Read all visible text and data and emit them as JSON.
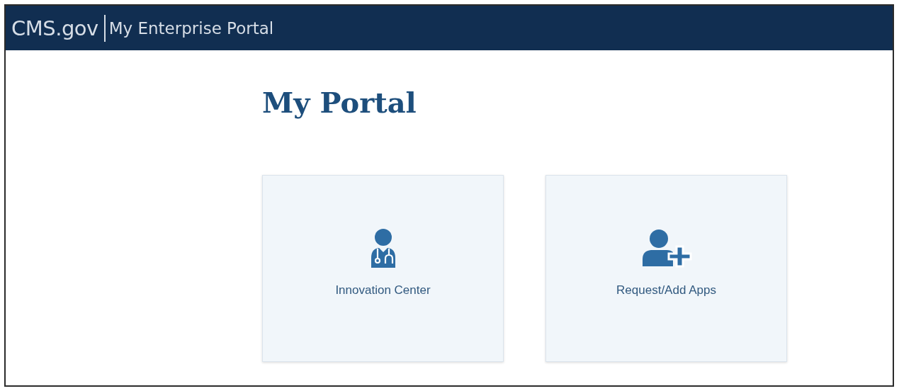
{
  "header": {
    "logo": "CMS.gov",
    "title": "My Enterprise Portal"
  },
  "page_title": "My Portal",
  "tiles": [
    {
      "kind": "doctor",
      "label": "Innovation Center"
    },
    {
      "kind": "add-user",
      "label": "Request/Add Apps"
    }
  ]
}
